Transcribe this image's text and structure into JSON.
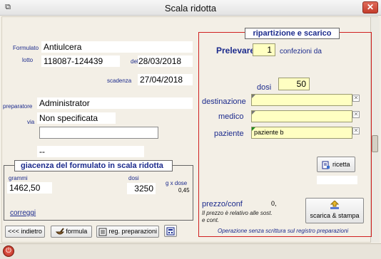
{
  "window": {
    "title": "Scala ridotta"
  },
  "header": {
    "formulato_label": "Formulato",
    "formulato_value": "Antiulcera",
    "lotto_label": "lotto",
    "lotto_value": "118087-124439",
    "del_label": "del",
    "del_value": "28/03/2018",
    "scadenza_label": "scadenza",
    "scadenza_value": "27/04/2018",
    "preparatore_label": "preparatore",
    "preparatore_value": "Administrator",
    "via_label": "via",
    "via_value": "Non specificata",
    "extra_value": "--"
  },
  "giacenza": {
    "title": "giacenza del formulato in scala ridotta",
    "grammi_label": "grammi",
    "grammi_value": "1462,50",
    "dosi_label": "dosi",
    "dosi_value": "3250",
    "gxdose_label": "g x dose",
    "gxdose_value": "0,45",
    "correggi_link": "correggi"
  },
  "ripartizione": {
    "title": "ripartizione e scarico",
    "prelevare_label": "Prelevare",
    "prelevare_value": "1",
    "confezioni_label": "confezioni da",
    "dosi_label": "dosi",
    "dosi_value": "50",
    "destinazione_label": "destinazione",
    "destinazione_value": "",
    "medico_label": "medico",
    "medico_value": "",
    "paziente_label": "paziente",
    "paziente_value": "paziente b",
    "ricetta_label": "ricetta",
    "prezzo_label": "prezzo/conf",
    "prezzo_value": "0,",
    "prezzo_note": "Il prezzo è relativo alle sost. e cont.",
    "scarica_label": "scarica & stampa",
    "footer_note": "Operazione senza scrittura sul registro preparazioni"
  },
  "buttons": {
    "indietro": "<<< indietro",
    "formula": "formula",
    "reg_preparazioni": "reg. preparazioni"
  },
  "colors": {
    "accent_red": "#d02020",
    "label_blue": "#1b2a8c",
    "field_yellow": "#ffffc2"
  }
}
